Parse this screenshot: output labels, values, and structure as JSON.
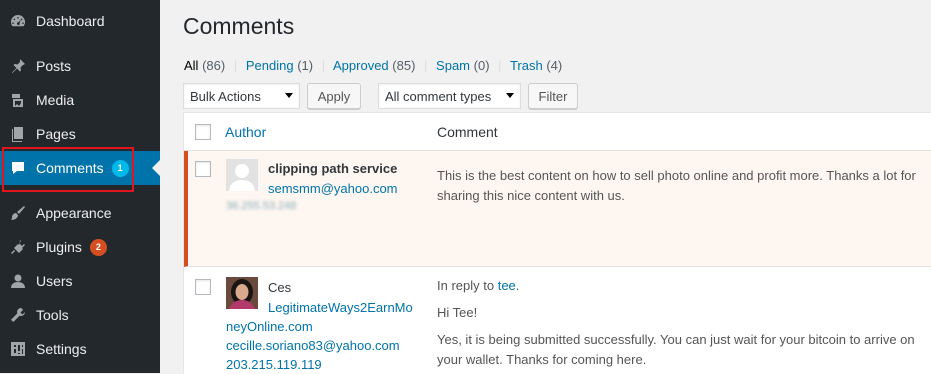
{
  "sidebar": {
    "items": [
      {
        "label": "Dashboard",
        "icon": "dashboard-icon"
      },
      {
        "label": "Posts",
        "icon": "pin-icon"
      },
      {
        "label": "Media",
        "icon": "media-icon"
      },
      {
        "label": "Pages",
        "icon": "pages-icon"
      },
      {
        "label": "Comments",
        "icon": "comment-icon",
        "badge": "1",
        "current": true
      },
      {
        "label": "Appearance",
        "icon": "brush-icon"
      },
      {
        "label": "Plugins",
        "icon": "plugin-icon",
        "badge": "2"
      },
      {
        "label": "Users",
        "icon": "user-icon"
      },
      {
        "label": "Tools",
        "icon": "wrench-icon"
      },
      {
        "label": "Settings",
        "icon": "settings-icon"
      }
    ]
  },
  "page": {
    "title": "Comments"
  },
  "filters": {
    "all": {
      "label": "All",
      "count": "(86)"
    },
    "pending": {
      "label": "Pending",
      "count": "(1)"
    },
    "approved": {
      "label": "Approved",
      "count": "(85)"
    },
    "spam": {
      "label": "Spam",
      "count": "(0)"
    },
    "trash": {
      "label": "Trash",
      "count": "(4)"
    },
    "separator": "|"
  },
  "toolbar": {
    "bulk_actions": "Bulk Actions",
    "apply": "Apply",
    "comment_types": "All comment types",
    "filter": "Filter"
  },
  "table": {
    "columns": {
      "author": "Author",
      "comment": "Comment"
    },
    "rows": [
      {
        "author": "clipping path service",
        "email": "semsmm@yahoo.com",
        "ip_blurred": "36.255.53.248",
        "text": "This is the best content on how to sell photo online and profit more. Thanks a lot for sharing this nice content with us.",
        "pending": true
      },
      {
        "author": "Ces",
        "url_line1": "LegitimateWays2EarnMo",
        "url_line2": "neyOnline.com",
        "email": "cecille.soriano83@yahoo.com",
        "ip": "203.215.119.119",
        "in_reply_prefix": "In reply to ",
        "in_reply_link": "tee",
        "in_reply_suffix": ".",
        "greeting": "Hi Tee!",
        "text": "Yes, it is being submitted successfully. You can just wait for your bitcoin to arrive on your wallet. Thanks for coming here."
      }
    ]
  },
  "colors": {
    "sidebar_bg": "#23282d",
    "accent": "#0073aa",
    "pending_border": "#d54e21",
    "badge_blue": "#00b9eb",
    "highlight": "#e0161e"
  }
}
